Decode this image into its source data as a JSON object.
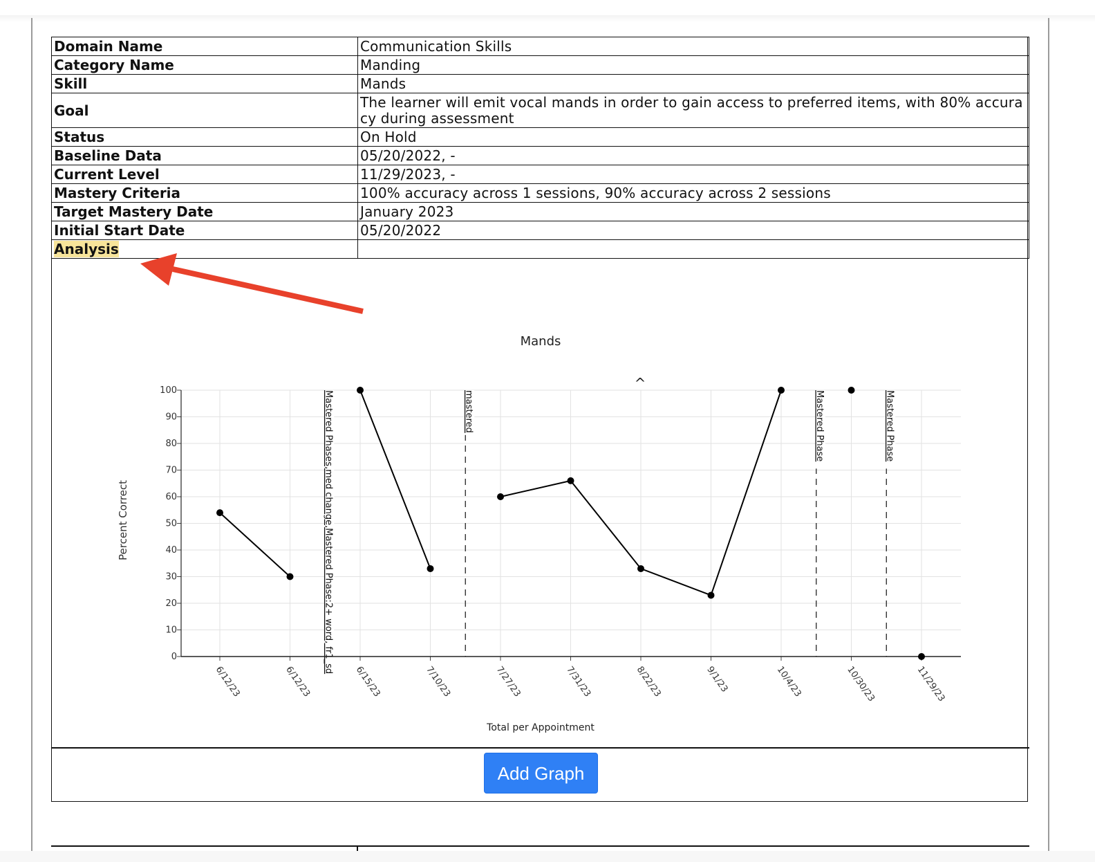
{
  "info_table": {
    "rows": [
      {
        "key": "Domain Name",
        "value": "Communication Skills"
      },
      {
        "key": "Category Name",
        "value": "Manding"
      },
      {
        "key": "Skill",
        "value": "Mands"
      },
      {
        "key": "Goal",
        "value": "The learner will emit vocal mands in order to gain access to preferred items, with 80% accuracy during assessment"
      },
      {
        "key": "Status",
        "value": "On Hold"
      },
      {
        "key": "Baseline Data",
        "value": "05/20/2022, -"
      },
      {
        "key": "Current Level",
        "value": "11/29/2023, -"
      },
      {
        "key": "Mastery Criteria",
        "value": "100% accuracy across 1 sessions, 90% accuracy across 2 sessions"
      },
      {
        "key": "Target Mastery Date",
        "value": "January 2023"
      },
      {
        "key": "Initial Start Date",
        "value": "05/20/2022"
      },
      {
        "key": "Analysis",
        "value": ""
      }
    ],
    "highlight_color": "#f7e49a"
  },
  "annotation": {
    "type": "red-arrow",
    "color": "#e8412b",
    "points_to": "Analysis"
  },
  "chart_data": {
    "type": "line",
    "title": "Mands",
    "xlabel": "Total per Appointment",
    "ylabel": "Percent Correct",
    "ylim": [
      0,
      100
    ],
    "yticks": [
      0,
      10,
      20,
      30,
      40,
      50,
      60,
      70,
      80,
      90,
      100
    ],
    "grid": true,
    "categories": [
      "6/12/23",
      "6/12/23",
      "6/15/23",
      "7/10/23",
      "7/27/23",
      "7/31/23",
      "8/22/23",
      "9/1/23",
      "10/4/23",
      "10/30/23",
      "11/29/23"
    ],
    "segments": [
      {
        "indices": [
          0,
          1
        ],
        "values": [
          54,
          30
        ]
      },
      {
        "indices": [
          2,
          3
        ],
        "values": [
          100,
          33
        ]
      },
      {
        "indices": [
          4,
          5,
          6,
          7,
          8
        ],
        "values": [
          60,
          66,
          33,
          23,
          100
        ]
      },
      {
        "indices": [
          9
        ],
        "values": [
          100
        ]
      },
      {
        "indices": [
          10
        ],
        "values": [
          0
        ]
      }
    ],
    "phase_lines": [
      {
        "after_index": 1,
        "label": "Mastered Phases,med change,Mastered Phase:2+ word, fr1_sd"
      },
      {
        "after_index": 3,
        "label": "mastered"
      },
      {
        "after_index": 8,
        "label": "Mastered Phase"
      },
      {
        "after_index": 9,
        "label": "Mastered Phase"
      }
    ],
    "marker_glyph": "^",
    "line_color": "#000000",
    "grid_color": "#e2e2e2"
  },
  "actions": {
    "add_graph_label": "Add Graph"
  },
  "colors": {
    "button": "#2f80f5",
    "border": "#111111"
  }
}
